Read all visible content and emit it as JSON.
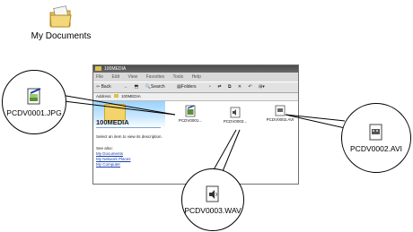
{
  "desktop": {
    "icon_label": "My Documents"
  },
  "window": {
    "title": "100MEDIA",
    "menu": [
      "File",
      "Edit",
      "View",
      "Favorites",
      "Tools",
      "Help"
    ],
    "toolbar": {
      "back": "Back",
      "forward": "→",
      "search": "Search",
      "folders": "Folders",
      "views": "⊞▾"
    },
    "address": {
      "label": "Address",
      "value": "100MEDIA"
    },
    "left_pane": {
      "title": "100MEDIA",
      "description": "Select an item to view its description.",
      "see_also": "See also:",
      "links": [
        "My Documents",
        "My Network Places",
        "My Computer"
      ]
    },
    "files": [
      {
        "name": "PCDV0001...",
        "icon": "image-file-icon"
      },
      {
        "name": "PCDV0003...",
        "icon": "audio-file-icon"
      },
      {
        "name": "PCDV0002.AVI",
        "icon": "video-file-icon"
      }
    ]
  },
  "callouts": {
    "jpg": "PCDV0001.JPG",
    "avi": "PCDV0002.AVI",
    "wav": "PCDV0003.WAV"
  }
}
